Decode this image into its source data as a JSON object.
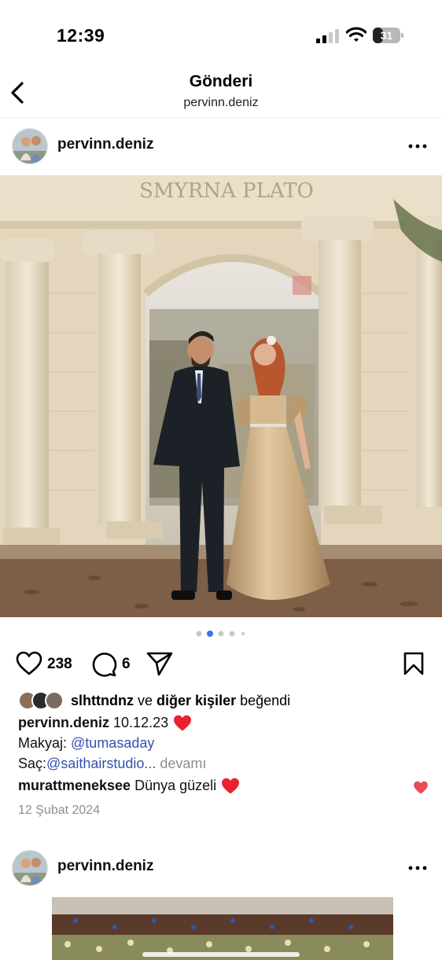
{
  "status_bar": {
    "time": "12:39",
    "battery": "31"
  },
  "header": {
    "title": "Gönderi",
    "subtitle": "pervinn.deniz"
  },
  "post": {
    "author": "pervinn.deniz",
    "image_caption_sign": "SMYRNA PLATO",
    "carousel": {
      "count": 5,
      "active_index": 1
    },
    "likes_count": "238",
    "comments_count": "6",
    "liked_by_user": "slhttndnz",
    "liked_by_connector": "ve",
    "liked_by_others": "diğer kişiler",
    "liked_by_suffix": "beğendi",
    "caption_author": "pervinn.deniz",
    "caption_text": "10.12.23",
    "makeup_label": "Makyaj:",
    "makeup_mention": "@tumasaday",
    "hair_label": "Saç:",
    "hair_mention": "@saithairstudio...",
    "more_label": "devamı",
    "comment_author": "murattmeneksee",
    "comment_text": "Dünya güzeli",
    "date": "12 Şubat 2024"
  },
  "next_post": {
    "author": "pervinn.deniz"
  },
  "colors": {
    "heart_red": "#ed4956",
    "mention_blue": "#3451b2",
    "carousel_active": "#3d73e6"
  }
}
